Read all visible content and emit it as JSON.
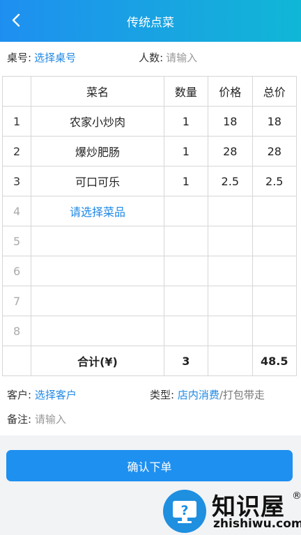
{
  "header": {
    "title": "传统点菜"
  },
  "table_info": {
    "table_label": "桌号:",
    "table_value": "选择桌号",
    "people_label": "人数:",
    "people_placeholder": "请输入"
  },
  "menu": {
    "columns": [
      "菜名",
      "数量",
      "价格",
      "总价"
    ],
    "rows": [
      {
        "idx": "1",
        "name": "农家小炒肉",
        "qty": "1",
        "price": "18",
        "total": "18"
      },
      {
        "idx": "2",
        "name": "爆炒肥肠",
        "qty": "1",
        "price": "28",
        "total": "28"
      },
      {
        "idx": "3",
        "name": "可口可乐",
        "qty": "1",
        "price": "2.5",
        "total": "2.5"
      },
      {
        "idx": "4",
        "name": "请选择菜品",
        "qty": "",
        "price": "",
        "total": ""
      },
      {
        "idx": "5",
        "name": "",
        "qty": "",
        "price": "",
        "total": ""
      },
      {
        "idx": "6",
        "name": "",
        "qty": "",
        "price": "",
        "total": ""
      },
      {
        "idx": "7",
        "name": "",
        "qty": "",
        "price": "",
        "total": ""
      },
      {
        "idx": "8",
        "name": "",
        "qty": "",
        "price": "",
        "total": ""
      }
    ],
    "summary": {
      "label": "合计(¥)",
      "qty": "3",
      "total": "48.5"
    }
  },
  "customer": {
    "label": "客户:",
    "value": "选择客户",
    "type_label": "类型:",
    "type_selected": "店内消费",
    "type_separator": "/",
    "type_other": "打包带走"
  },
  "note": {
    "label": "备注:",
    "placeholder": "请输入"
  },
  "confirm_label": "确认下单",
  "watermark": {
    "brand": "知识屋",
    "registered": "®",
    "domain": "zhishiwu.com"
  },
  "colors": {
    "header_start": "#1e8ff0",
    "header_end": "#10b7d6",
    "link": "#1e88e5",
    "button": "#1e90f0"
  }
}
